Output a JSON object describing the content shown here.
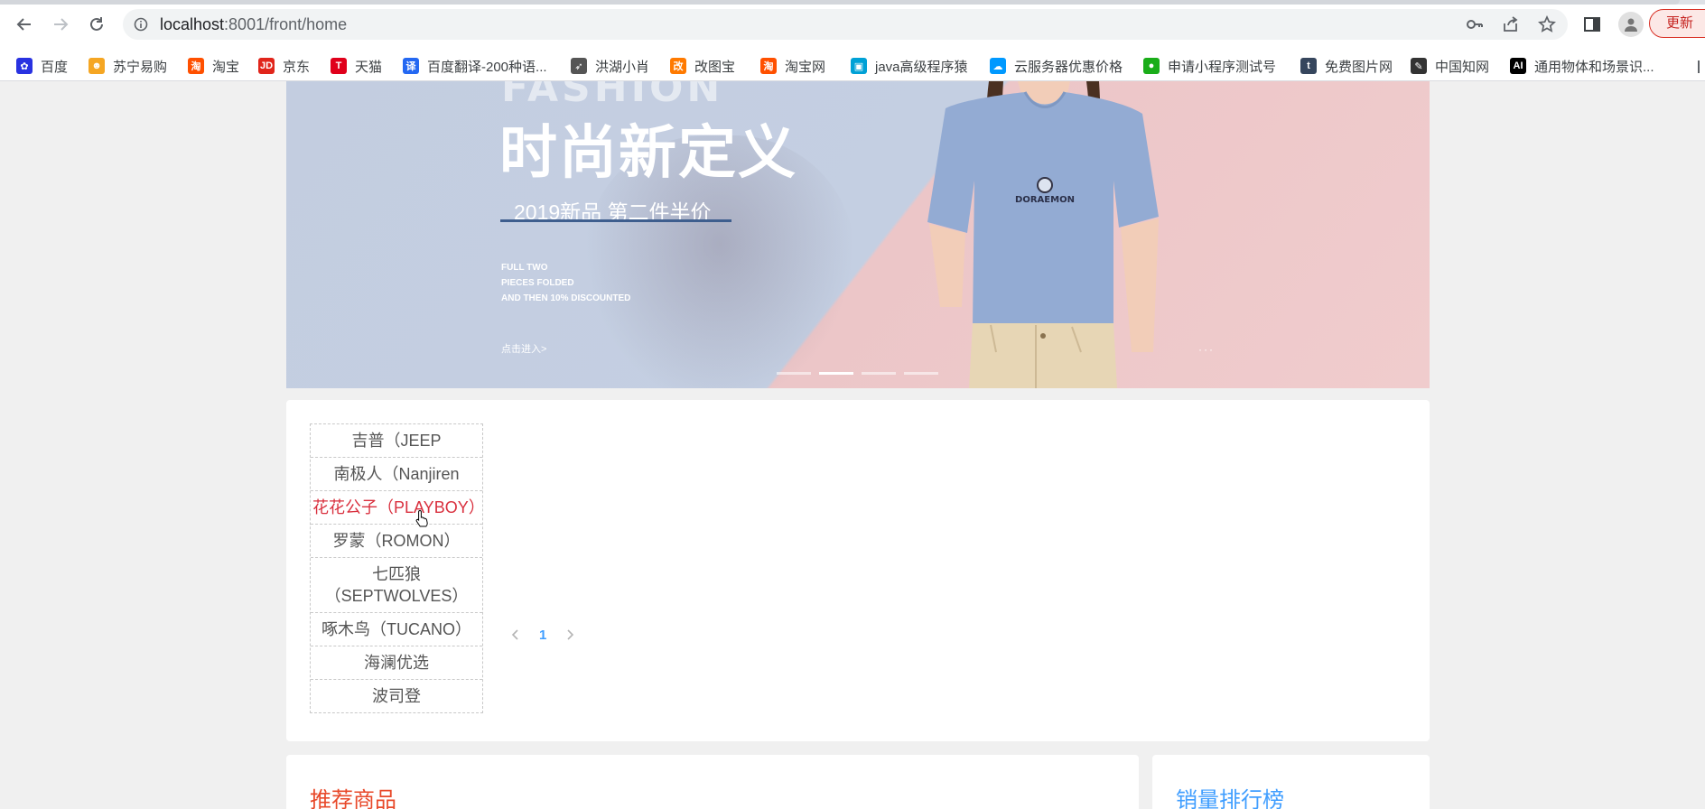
{
  "browser": {
    "url_host": "localhost",
    "url_path": ":8001/front/home",
    "update_label": "更新"
  },
  "bookmarks": [
    {
      "label": "百度",
      "icon": "baidu-paw-icon",
      "color": "#2932e1"
    },
    {
      "label": "苏宁易购",
      "icon": "suning-lion-icon",
      "color": "#f5a623"
    },
    {
      "label": "淘宝",
      "icon": "taobao-icon",
      "color": "#ff5000"
    },
    {
      "label": "京东",
      "icon": "jd-icon",
      "color": "#e1251b"
    },
    {
      "label": "天猫",
      "icon": "tmall-icon",
      "color": "#e0001b"
    },
    {
      "label": "百度翻译-200种语...",
      "icon": "translate-icon",
      "color": "#2468f2"
    },
    {
      "label": "洪湖小肖",
      "icon": "bird-icon",
      "color": "#555555"
    },
    {
      "label": "改图宝",
      "icon": "gaitubao-icon",
      "color": "#ff7a00"
    },
    {
      "label": "淘宝网",
      "icon": "taobao-net-icon",
      "color": "#ff5000"
    },
    {
      "label": "java高级程序猿",
      "icon": "bilibili-icon",
      "color": "#00a1d6"
    },
    {
      "label": "云服务器优惠价格",
      "icon": "cloud-icon",
      "color": "#0099ff"
    },
    {
      "label": "申请小程序测试号",
      "icon": "wechat-icon",
      "color": "#1aad19"
    },
    {
      "label": "免费图片网",
      "icon": "tumblr-icon",
      "color": "#36465d"
    },
    {
      "label": "中国知网",
      "icon": "cnki-icon",
      "color": "#333333"
    },
    {
      "label": "通用物体和场景识...",
      "icon": "ai-icon",
      "color": "#000000"
    }
  ],
  "banner": {
    "headline_bg": "FASHION",
    "headline": "时尚新定义",
    "subtitle": "2019新品 第二件半价",
    "small_lines": [
      "FULL TWO",
      "PIECES FOLDED",
      " AND THEN 10% DISCOUNTED"
    ],
    "enter_link": "点击进入>",
    "shirt_text": "DORAEMON",
    "dots": "···",
    "active_slide": 2,
    "slide_count": 4
  },
  "brands": {
    "items": [
      "吉普（JEEP",
      "南极人（Nanjiren",
      "花花公子（PLAYBOY）",
      "罗蒙（ROMON）",
      "七匹狼（SEPTWOLVES）",
      "啄木鸟（TUCANO）",
      "海澜优选",
      "波司登"
    ],
    "active_index": 2
  },
  "pagination": {
    "current": "1"
  },
  "sections": {
    "recommended_title": "推荐商品",
    "ranking_title": "销量排行榜"
  }
}
